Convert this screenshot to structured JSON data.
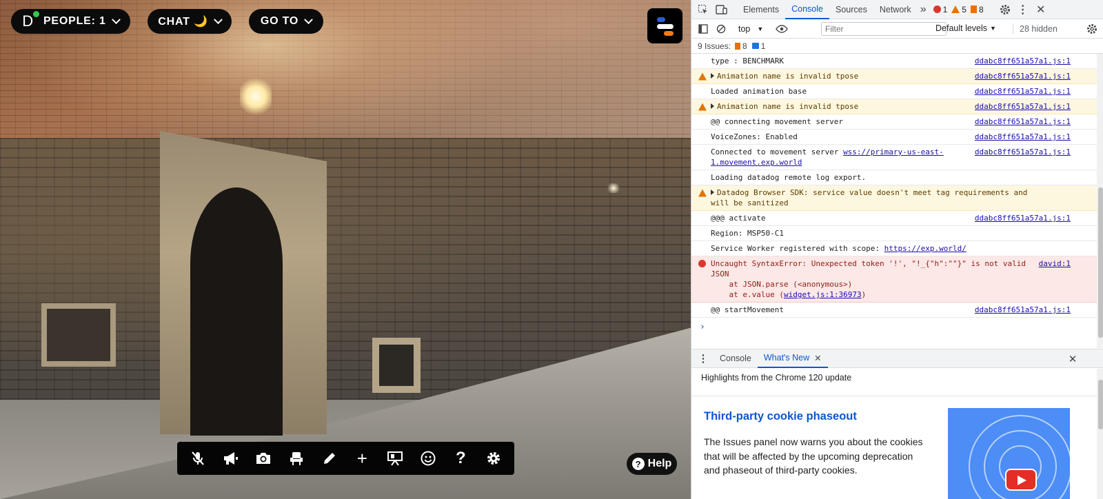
{
  "hud": {
    "people_logo": "D",
    "people_label": "PEOPLE: 1",
    "chat_label": "CHAT 🌙",
    "goto_label": "GO TO",
    "help_label": "Help",
    "help_glyph": "?"
  },
  "toolbar": {
    "items": [
      "mic-off-icon",
      "megaphone-icon",
      "camera-icon",
      "seat-icon",
      "pencil-icon",
      "plus-icon",
      "presentation-icon",
      "emoji-icon",
      "question-icon",
      "gear-icon"
    ],
    "plus_glyph": "+",
    "question_glyph": "?"
  },
  "devtools": {
    "tabs": [
      "Elements",
      "Console",
      "Sources",
      "Network"
    ],
    "active_tab": "Console",
    "more_tabs": "»",
    "error_count": "1",
    "warning_count": "5",
    "issue_count": "8",
    "context": "top",
    "filter_placeholder": "Filter",
    "levels": "Default levels",
    "hidden": "28 hidden",
    "issues_label": "9 Issues:",
    "issues_orange": "8",
    "issues_blue": "1",
    "logs": [
      {
        "level": "info",
        "text": "type : BENCHMARK",
        "src": "ddabc8ff651a57a1.js:1"
      },
      {
        "level": "warn",
        "text": "Animation name is invalid tpose",
        "src": "ddabc8ff651a57a1.js:1"
      },
      {
        "level": "info",
        "text": "Loaded animation base",
        "src": "ddabc8ff651a57a1.js:1"
      },
      {
        "level": "warn",
        "text": "Animation name is invalid tpose",
        "src": "ddabc8ff651a57a1.js:1"
      },
      {
        "level": "info",
        "text": "@@ connecting movement server",
        "src": "ddabc8ff651a57a1.js:1"
      },
      {
        "level": "info",
        "text": "VoiceZones: Enabled",
        "src": "ddabc8ff651a57a1.js:1"
      },
      {
        "level": "info",
        "text": "Connected to movement server ",
        "link": "wss://primary-us-east-1.movement.exp.world",
        "src": "ddabc8ff651a57a1.js:1"
      },
      {
        "level": "info",
        "text": "Loading datadog remote log export.",
        "src": ""
      },
      {
        "level": "warn",
        "text": "Datadog Browser SDK: service value doesn't meet tag requirements and will be sanitized",
        "src": ""
      },
      {
        "level": "info",
        "text": "@@@ activate",
        "src": "ddabc8ff651a57a1.js:1"
      },
      {
        "level": "info",
        "text": "Region: MSP50-C1",
        "src": ""
      },
      {
        "level": "info",
        "text": "Service Worker registered with scope: ",
        "link": "https://exp.world/",
        "src": ""
      },
      {
        "level": "error",
        "text": "Uncaught SyntaxError: Unexpected token '!', \"!_{\"h\":\"\"}\" is not valid JSON\n    at JSON.parse (<anonymous>)\n    at e.value (",
        "link": "widget.js:1:36973",
        "tail": ")",
        "src": "david:1"
      },
      {
        "level": "info",
        "text": "@@ startMovement",
        "src": "ddabc8ff651a57a1.js:1"
      }
    ],
    "prompt": "›",
    "drawer_tabs": [
      "Console",
      "What's New"
    ],
    "drawer_active": "What's New",
    "highlights": "Highlights from the Chrome 120 update",
    "whats_new_title": "Third-party cookie phaseout",
    "whats_new_body": "The Issues panel now warns you about the cookies that will be affected by the upcoming deprecation and phaseout of third-party cookies."
  },
  "colors": {
    "accent": "#0b57d0",
    "error": "#dc362e",
    "warning": "#e37400",
    "online": "#35c64a"
  }
}
